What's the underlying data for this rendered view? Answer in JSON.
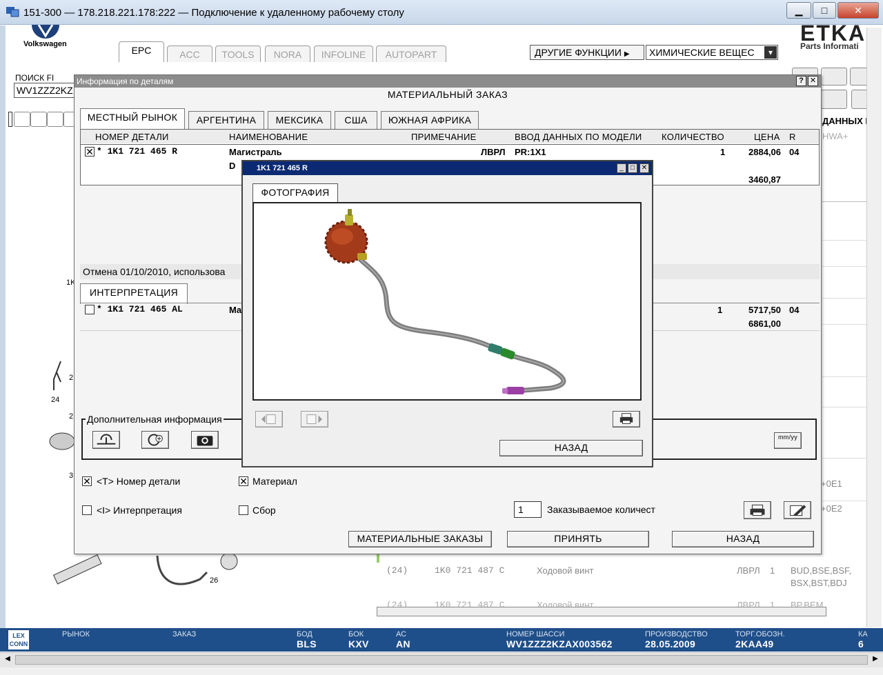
{
  "window": {
    "title": "151-300 — 178.218.221.178:222 — Подключение к удаленному рабочему столу",
    "min": "▁",
    "max": "□",
    "close": "✕"
  },
  "brand": {
    "vw_label": "Volkswagen",
    "etka_logo": "ETKA",
    "etka_sub": "Parts Informati"
  },
  "top_tabs": [
    "EPC",
    "ACC",
    "TOOLS",
    "NORA",
    "INFOLINE",
    "AUTOPART"
  ],
  "other_functions": {
    "label": "ДРУГИЕ ФУНКЦИИ",
    "arrow": "▶",
    "selected": "ХИМИЧЕСКИЕ ВЕЩЕС",
    "dropdown_arrow": "▾"
  },
  "search": {
    "label": "ПОИСК FI",
    "value": "WV1ZZZ2KZ"
  },
  "bg_right": {
    "data_label": "ДАННЫХ П",
    "hwa": "HWA+",
    "code1": "+0E1",
    "code2": "+0E2"
  },
  "bg_left": {
    "n24": "24",
    "n1k": "1K",
    "n26": "26",
    "n2a": "2",
    "n2b": "2",
    "n3": "3"
  },
  "bg_rows": [
    {
      "pos": "(24)",
      "part": "1K0 721 487 C",
      "name": "Ходовой винт",
      "mark": "ЛВРЛ",
      "qty": "1",
      "model": "BUD,BSE,BSF,",
      "model2": "BSX,BST,BDJ"
    },
    {
      "pos": "(24)",
      "part": "1K0 721 487 C",
      "name": "Ходовой винт",
      "mark": "ЛВРЛ",
      "qty": "1",
      "model": "BP,BEM"
    }
  ],
  "dialog": {
    "header": "Информация по деталям",
    "help": "?",
    "close": "✕",
    "title": "МАТЕРИАЛЬНЫЙ ЗАКАЗ",
    "market_tabs": [
      "МЕСТНЫЙ РЫНОК",
      "АРГЕНТИНА",
      "МЕКСИКА",
      "США",
      "ЮЖНАЯ АФРИКА"
    ],
    "columns": [
      "НОМЕР ДЕТАЛИ",
      "НАИМЕНОВАНИЕ",
      "ПРИМЕЧАНИЕ",
      "ВВОД ДАННЫХ ПО МОДЕЛИ",
      "КОЛИЧЕСТВО",
      "ЦЕНА",
      "R"
    ],
    "row1": {
      "checked": "✕",
      "part": "* 1K1 721 465 R",
      "name": "Магистраль",
      "name_line2": "D",
      "note": "ЛВРЛ",
      "model": "PR:1X1",
      "qty": "1",
      "price": "2884,06",
      "price2": "3460,87",
      "r": "04"
    },
    "cancel_note": "Отмена 01/10/2010, использова",
    "interp_tab": "ИНТЕРПРЕТАЦИЯ",
    "row2": {
      "part": "* 1K1 721 465 AL",
      "name": "Ma",
      "qty": "1",
      "price": "5717,50",
      "price2": "6861,00",
      "r": "04"
    },
    "extra_info": "Дополнительная информация",
    "mm_yy": "mm/yy",
    "opt_part_number": "<T> Номер детали",
    "opt_material": "Материал",
    "opt_interpretation": "<I> Интерпретация",
    "opt_assembly": "Сбор",
    "order_qty_value": "1",
    "order_qty_label": "Заказываемое количест",
    "btn_material_orders": "МАТЕРИАЛЬНЫЕ ЗАКАЗЫ",
    "btn_accept": "ПРИНЯТЬ",
    "btn_back": "НАЗАД",
    "checked_mark": "✕"
  },
  "popup": {
    "title": "1K1 721 465 R",
    "tab": "ФОТОГРАФИЯ",
    "back": "НАЗАД",
    "min": "_",
    "max": "□",
    "close": "✕"
  },
  "status": {
    "labels": [
      "РЫНОК",
      "ЗАКАЗ",
      "БОД",
      "БОК",
      "АС",
      "НОМЕР ШАССИ",
      "ПРОИЗВОДСТВО",
      "ТОРГ.ОБОЗН.",
      "КА"
    ],
    "values": [
      "",
      "",
      "BLS",
      "KXV",
      "AN",
      "WV1ZZZ2KZAX003562",
      "28.05.2009",
      "2KAA49",
      "6"
    ],
    "lex_logo": "LEX CONN"
  },
  "colors": {
    "status_bar": "#1f4f8a",
    "popup_title": "#0b2a73",
    "part_red": "#a33a1a",
    "hose_gray": "#7d7d7d"
  }
}
